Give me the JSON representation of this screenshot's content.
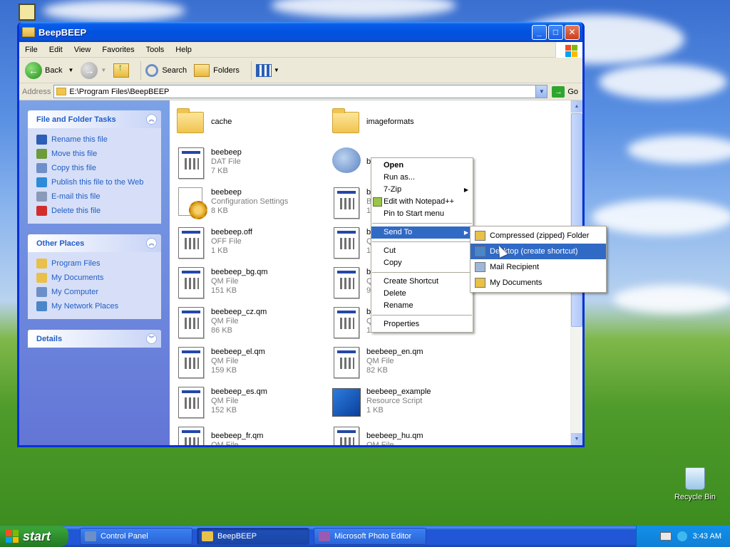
{
  "desktop": {
    "recycle_bin_label": "Recycle Bin"
  },
  "window": {
    "title": "BeepBEEP",
    "controls": {
      "minimize": "_",
      "maximize": "□",
      "close": "✕"
    }
  },
  "menubar": [
    "File",
    "Edit",
    "View",
    "Favorites",
    "Tools",
    "Help"
  ],
  "toolbar": {
    "back_label": "Back",
    "search_label": "Search",
    "folders_label": "Folders"
  },
  "address": {
    "label": "Address",
    "value": "E:\\Program Files\\BeepBEEP",
    "go_label": "Go"
  },
  "left_pane": {
    "file_tasks": {
      "title": "File and Folder Tasks",
      "items": [
        {
          "label": "Rename this file",
          "icon": "rename-icon",
          "color": "#2c5fb5"
        },
        {
          "label": "Move this file",
          "icon": "move-icon",
          "color": "#6b9b3a"
        },
        {
          "label": "Copy this file",
          "icon": "copy-icon",
          "color": "#6f8fc8"
        },
        {
          "label": "Publish this file to the Web",
          "icon": "globe-icon",
          "color": "#2f8ad8"
        },
        {
          "label": "E-mail this file",
          "icon": "email-icon",
          "color": "#8a9ab8"
        },
        {
          "label": "Delete this file",
          "icon": "delete-icon",
          "color": "#d22d2d"
        }
      ]
    },
    "other_places": {
      "title": "Other Places",
      "items": [
        {
          "label": "Program Files",
          "icon": "folder-icon",
          "color": "#e8c04a"
        },
        {
          "label": "My Documents",
          "icon": "my-documents-icon",
          "color": "#e8c04a"
        },
        {
          "label": "My Computer",
          "icon": "my-computer-icon",
          "color": "#6d8fc8"
        },
        {
          "label": "My Network Places",
          "icon": "network-icon",
          "color": "#4a86c8"
        }
      ]
    },
    "details": {
      "title": "Details"
    }
  },
  "files": {
    "col1": [
      {
        "name": "cache",
        "type": "",
        "size": "",
        "kind": "folder"
      },
      {
        "name": "beebeep",
        "type": "DAT File",
        "size": "7 KB",
        "kind": "doc"
      },
      {
        "name": "beebeep",
        "type": "Configuration Settings",
        "size": "8 KB",
        "kind": "cfg"
      },
      {
        "name": "beebeep.off",
        "type": "OFF File",
        "size": "1 KB",
        "kind": "doc"
      },
      {
        "name": "beebeep_bg.qm",
        "type": "QM File",
        "size": "151 KB",
        "kind": "doc"
      },
      {
        "name": "beebeep_cz.qm",
        "type": "QM File",
        "size": "86 KB",
        "kind": "doc"
      },
      {
        "name": "beebeep_el.qm",
        "type": "QM File",
        "size": "159 KB",
        "kind": "doc"
      },
      {
        "name": "beebeep_es.qm",
        "type": "QM File",
        "size": "152 KB",
        "kind": "doc"
      },
      {
        "name": "beebeep_fr.qm",
        "type": "QM File",
        "size": "",
        "kind": "doc"
      }
    ],
    "col2": [
      {
        "name": "imageformats",
        "type": "",
        "size": "",
        "kind": "folder"
      },
      {
        "name": "be",
        "type": "",
        "size": "",
        "kind": "bee"
      },
      {
        "name": "be",
        "type": "B",
        "size": "1",
        "kind": "doc"
      },
      {
        "name": "b",
        "type": "Q",
        "size": "1",
        "kind": "doc"
      },
      {
        "name": "b",
        "type": "Q",
        "size": "9",
        "kind": "doc"
      },
      {
        "name": "b",
        "type": "Q",
        "size": "1",
        "kind": "doc"
      },
      {
        "name": "beebeep_en.qm",
        "type": "QM File",
        "size": "82 KB",
        "kind": "doc"
      },
      {
        "name": "beebeep_example",
        "type": "Resource Script",
        "size": "1 KB",
        "kind": "res"
      },
      {
        "name": "beebeep_hu.qm",
        "type": "QM File",
        "size": "",
        "kind": "doc"
      }
    ]
  },
  "context_menu": {
    "items": [
      {
        "label": "Open",
        "bold": true
      },
      {
        "label": "Run as..."
      },
      {
        "label": "7-Zip",
        "submenu": true
      },
      {
        "label": "Edit with Notepad++",
        "icon": true
      },
      {
        "label": "Pin to Start menu"
      },
      {
        "sep": true
      },
      {
        "label": "Send To",
        "submenu": true,
        "highlight": true
      },
      {
        "sep": true
      },
      {
        "label": "Cut"
      },
      {
        "label": "Copy"
      },
      {
        "sep": true
      },
      {
        "label": "Create Shortcut"
      },
      {
        "label": "Delete"
      },
      {
        "label": "Rename"
      },
      {
        "sep": true
      },
      {
        "label": "Properties"
      }
    ]
  },
  "send_to_menu": {
    "items": [
      {
        "label": "Compressed (zipped) Folder",
        "color": "#e8c04a"
      },
      {
        "label": "Desktop (create shortcut)",
        "color": "#4a86c8",
        "highlight": true
      },
      {
        "label": "Mail Recipient",
        "color": "#a0b8d8"
      },
      {
        "label": "My Documents",
        "color": "#e8c04a"
      }
    ]
  },
  "taskbar": {
    "start_label": "start",
    "buttons": [
      {
        "label": "Control Panel",
        "active": false,
        "color": "#6d8fc8"
      },
      {
        "label": "BeepBEEP",
        "active": true,
        "color": "#e8c04a"
      },
      {
        "label": "Microsoft Photo Editor",
        "active": false,
        "color": "#9a5ab0"
      }
    ],
    "clock": "3:43 AM"
  },
  "colors": {
    "title_blue": "#0053e1",
    "task_link": "#215dc6",
    "highlight": "#316ac5"
  }
}
